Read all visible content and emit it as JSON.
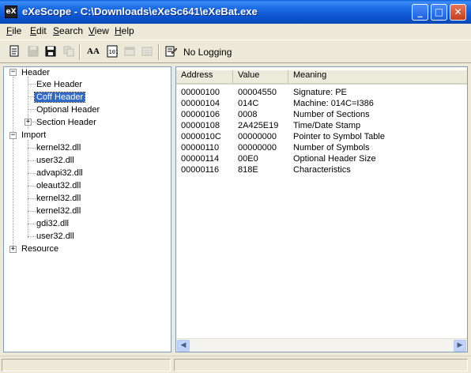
{
  "window": {
    "title": "eXeScope - C:\\Downloads\\eXeSc641\\eXeBat.exe",
    "icon_text": "eX",
    "minimize_icon": "minimize-icon",
    "maximize_icon": "maximize-icon",
    "close_icon": "close-icon"
  },
  "menu": {
    "items": [
      {
        "first": "F",
        "rest": "ile"
      },
      {
        "first": "E",
        "rest": "dit"
      },
      {
        "first": "S",
        "rest": "earch"
      },
      {
        "first": "V",
        "rest": "iew"
      },
      {
        "first": "H",
        "rest": "elp"
      }
    ]
  },
  "toolbar": {
    "logging_label": "No Logging",
    "icons": [
      "new-icon",
      "save-icon",
      "save-all-icon",
      "copy-icon",
      "font-icon",
      "binary-icon",
      "dialog-icon",
      "bitmap-icon",
      "logging-icon"
    ]
  },
  "tree": {
    "header": "Header",
    "exe_header": "Exe Header",
    "coff_header": "Coff Header",
    "optional_header": "Optional Header",
    "section_header": "Section Header",
    "import": "Import",
    "imports": [
      "kernel32.dll",
      "user32.dll",
      "advapi32.dll",
      "oleaut32.dll",
      "kernel32.dll",
      "kernel32.dll",
      "gdi32.dll",
      "user32.dll"
    ],
    "resource": "Resource",
    "expanded_symbol": "−",
    "collapsed_symbol": "+"
  },
  "list": {
    "columns": [
      "Address",
      "Value",
      "Meaning"
    ],
    "rows": [
      {
        "address": "00000100",
        "value": "00004550",
        "meaning": "Signature: PE"
      },
      {
        "address": "00000104",
        "value": "014C",
        "meaning": "Machine: 014C=I386"
      },
      {
        "address": "00000106",
        "value": "0008",
        "meaning": "Number of Sections"
      },
      {
        "address": "00000108",
        "value": "2A425E19",
        "meaning": "Time/Date Stamp"
      },
      {
        "address": "0000010C",
        "value": "00000000",
        "meaning": "Pointer to Symbol Table"
      },
      {
        "address": "00000110",
        "value": "00000000",
        "meaning": "Number of Symbols"
      },
      {
        "address": "00000114",
        "value": "00E0",
        "meaning": "Optional Header Size"
      },
      {
        "address": "00000116",
        "value": "818E",
        "meaning": "Characteristics"
      }
    ]
  },
  "colors": {
    "titlebar": "#0a5fd8",
    "selection": "#316ac5"
  }
}
